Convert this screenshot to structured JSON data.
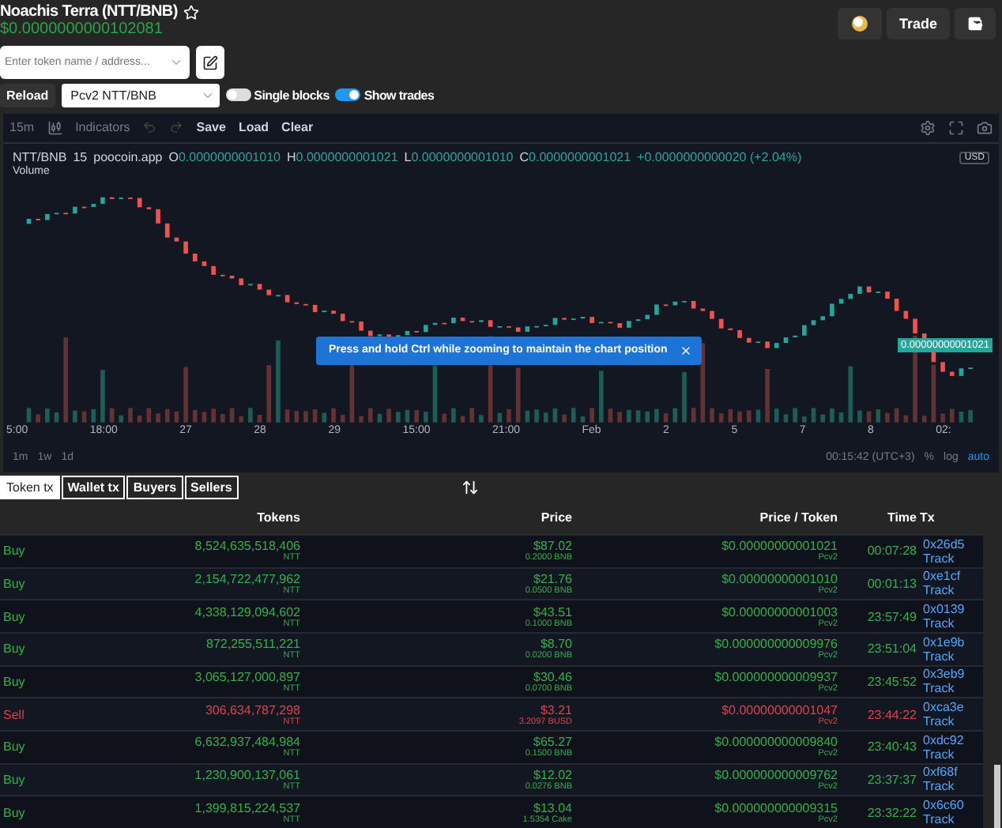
{
  "token": {
    "name": "Noachis Terra (NTT/BNB)",
    "price": "$0.0000000000102081",
    "starred": false
  },
  "header_buttons": [
    {
      "kind": "icon"
    },
    {
      "kind": "text",
      "label": "Trade"
    },
    {
      "kind": "wallet"
    }
  ],
  "search": {
    "placeholder": "Enter token name / address..."
  },
  "controls": {
    "reload": "Reload",
    "pair": "Pcv2 NTT/BNB",
    "toggles": [
      {
        "label": "Single blocks",
        "on": false
      },
      {
        "label": "Show trades",
        "on": true
      }
    ]
  },
  "chart": {
    "toolbar": {
      "interval": "15m",
      "indicators": "Indicators",
      "actions": [
        "Save",
        "Load",
        "Clear"
      ]
    },
    "legend": {
      "symbol": "NTT/BNB",
      "interval": "15",
      "source": "poocoin.app",
      "ohlc": [
        {
          "key": "O",
          "value": "0.0000000001010"
        },
        {
          "key": "H",
          "value": "0.0000000001021"
        },
        {
          "key": "L",
          "value": "0.0000000001010"
        },
        {
          "key": "C",
          "value": "0.0000000001021"
        }
      ],
      "change": "+0.0000000000020 (+2.04%)",
      "volume": "Volume"
    },
    "currency": "USD",
    "last_price": "0.00000000001021",
    "toast": "Press and hold Ctrl while zooming to maintain the chart position",
    "x_labels": [
      "5:00",
      "18:00",
      "27",
      "28",
      "29",
      "15:00",
      "21:00",
      "Feb",
      "2",
      "5",
      "7",
      "8",
      "02:"
    ],
    "ranges": [
      "1m",
      "1w",
      "1d"
    ],
    "clock": "00:15:42 (UTC+3)",
    "scale_options": [
      {
        "label": "%",
        "selected": false
      },
      {
        "label": "log",
        "selected": false
      },
      {
        "label": "auto",
        "selected": true
      }
    ]
  },
  "tabs": [
    {
      "label": "Token tx",
      "selected": true
    },
    {
      "label": "Wallet tx",
      "selected": false
    },
    {
      "label": "Buyers",
      "selected": false
    },
    {
      "label": "Sellers",
      "selected": false
    }
  ],
  "table": {
    "columns": [
      "Tokens",
      "Price",
      "Price / Token",
      "Time",
      "Tx"
    ],
    "rows": [
      {
        "kind": "buy",
        "type": "Buy",
        "tokens": "8,524,635,518,406",
        "unit": "NTT",
        "price": "$87.02",
        "amount": "0.2000 BNB",
        "per_token": "$0.00000000001021",
        "pool": "Pcv2",
        "time": "00:07:28",
        "hash": "0x26d5",
        "track": "Track"
      },
      {
        "kind": "buy",
        "type": "Buy",
        "tokens": "2,154,722,477,962",
        "unit": "NTT",
        "price": "$21.76",
        "amount": "0.0500 BNB",
        "per_token": "$0.00000000001010",
        "pool": "Pcv2",
        "time": "00:01:13",
        "hash": "0xe1cf",
        "track": "Track"
      },
      {
        "kind": "buy",
        "type": "Buy",
        "tokens": "4,338,129,094,602",
        "unit": "NTT",
        "price": "$43.51",
        "amount": "0.1000 BNB",
        "per_token": "$0.00000000001003",
        "pool": "Pcv2",
        "time": "23:57:49",
        "hash": "0x0139",
        "track": "Track"
      },
      {
        "kind": "buy",
        "type": "Buy",
        "tokens": "872,255,511,221",
        "unit": "NTT",
        "price": "$8.70",
        "amount": "0.0200 BNB",
        "per_token": "$0.000000000009976",
        "pool": "Pcv2",
        "time": "23:51:04",
        "hash": "0x1e9b",
        "track": "Track"
      },
      {
        "kind": "buy",
        "type": "Buy",
        "tokens": "3,065,127,000,897",
        "unit": "NTT",
        "price": "$30.46",
        "amount": "0.0700 BNB",
        "per_token": "$0.000000000009937",
        "pool": "Pcv2",
        "time": "23:45:52",
        "hash": "0x3eb9",
        "track": "Track"
      },
      {
        "kind": "sell",
        "type": "Sell",
        "tokens": "306,634,787,298",
        "unit": "NTT",
        "price": "$3.21",
        "amount": "3.2097 BUSD",
        "per_token": "$0.00000000001047",
        "pool": "Pcv2",
        "time": "23:44:22",
        "hash": "0xca3e",
        "track": "Track"
      },
      {
        "kind": "buy",
        "type": "Buy",
        "tokens": "6,632,937,484,984",
        "unit": "NTT",
        "price": "$65.27",
        "amount": "0.1500 BNB",
        "per_token": "$0.000000000009840",
        "pool": "Pcv2",
        "time": "23:40:43",
        "hash": "0xdc92",
        "track": "Track"
      },
      {
        "kind": "buy",
        "type": "Buy",
        "tokens": "1,230,900,137,061",
        "unit": "NTT",
        "price": "$12.02",
        "amount": "0.0276 BNB",
        "per_token": "$0.000000000009762",
        "pool": "Pcv2",
        "time": "23:37:37",
        "hash": "0xf68f",
        "track": "Track"
      },
      {
        "kind": "buy",
        "type": "Buy",
        "tokens": "1,399,815,224,537",
        "unit": "NTT",
        "price": "$13.04",
        "amount": "1.5354 Cake",
        "per_token": "$0.000000000009315",
        "pool": "Pcv2",
        "time": "23:32:22",
        "hash": "0x6c60",
        "track": "Track"
      }
    ]
  }
}
